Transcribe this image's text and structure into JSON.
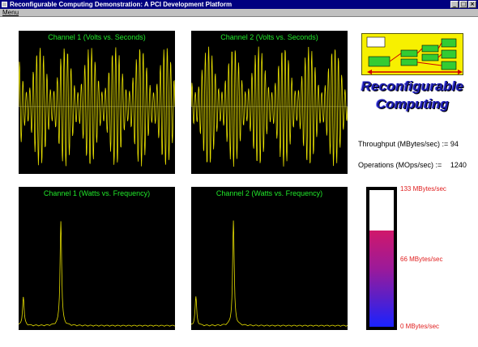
{
  "window": {
    "title": "Reconfigurable Computing Demonstration:  A PCI Development Platform",
    "buttons": {
      "minimize": "_",
      "maximize": "□",
      "close": "×"
    }
  },
  "menubar": {
    "items": [
      {
        "label": "Menu"
      }
    ]
  },
  "plots": [
    {
      "title": "Channel 1 (Volts vs. Seconds)"
    },
    {
      "title": "Channel 2 (Volts vs. Seconds)"
    },
    {
      "title": "Channel 1 (Watts vs. Frequency)"
    },
    {
      "title": "Channel 2 (Watts vs. Frequency)"
    }
  ],
  "logo": {
    "line1": "Reconfigurable",
    "line2": "Computing"
  },
  "throughput": {
    "label": "Throughput (MBytes/sec) :=",
    "value": "94"
  },
  "operations": {
    "label": "Operations (MOps/sec) :=",
    "value": "1240"
  },
  "meter": {
    "max_label": "133 MBytes/sec",
    "mid_label": "66  MBytes/sec",
    "min_label": "0  MBytes/sec",
    "max": 133,
    "value": 94
  },
  "colors": {
    "trace": "#e8e000",
    "plot_title": "#21e82a",
    "meter_label": "#e02020",
    "titlebar": "#000080"
  }
}
